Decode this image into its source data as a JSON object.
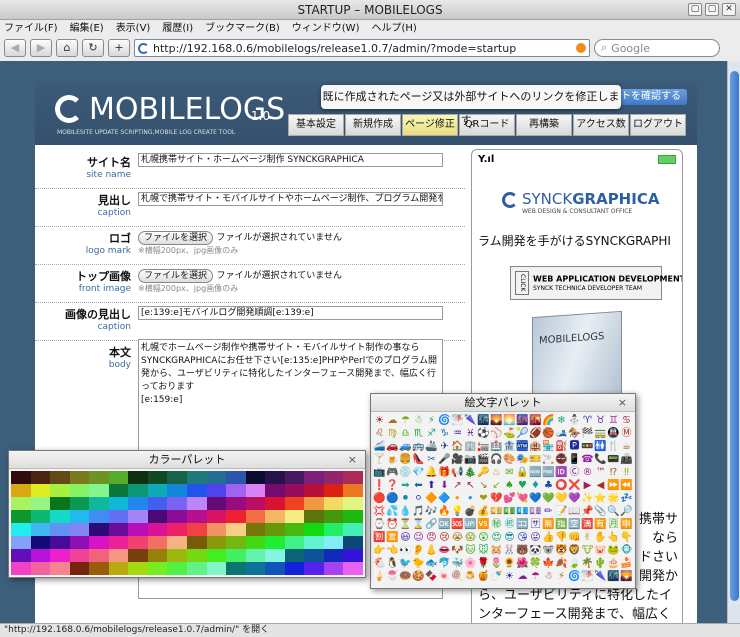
{
  "window": {
    "title": "STARTUP – MOBILELOGS",
    "buttons": [
      "▢",
      "▢",
      "✕"
    ]
  },
  "menu": [
    "ファイル(F)",
    "編集(E)",
    "表示(V)",
    "履歴(I)",
    "ブックマーク(B)",
    "ウィンドウ(W)",
    "ヘルプ(H)"
  ],
  "nav": {
    "back": "◀",
    "fwd": "▶",
    "home": "⌂",
    "reload": "↻",
    "add": "+",
    "url": "http://192.168.0.6/mobilelogs/release1.0.7/admin/?mode=startup",
    "search_placeholder": "Google"
  },
  "status": "\"http://192.168.0.6/mobilelogs/release1.0.7/admin/\" を開く",
  "header": {
    "logo": "MOBILELOGS",
    "version": "1.0",
    "tagline": "MOBILESITE UPDATE SCRIPTING,MOBILE LOG CREATE TOOL",
    "tooltip": "既に作成されたページ又は外部サイトへのリンクを修正します。",
    "confirm": "トを確認する",
    "tabs": [
      "基本設定",
      "新規作成",
      "ページ修正",
      "QRコード",
      "再構築",
      "アクセス数",
      "ログアウト"
    ]
  },
  "form": {
    "site_name": {
      "jp": "サイト名",
      "en": "site name",
      "value": "札幌携帯サイト・ホームページ制作 SYNCKGRAPHICA"
    },
    "caption": {
      "jp": "見出し",
      "en": "caption",
      "value": "札幌で携帯サイト・モバイルサイトやホームページ制作、プログラム開発を手がけ"
    },
    "logo": {
      "jp": "ロゴ",
      "en": "logo mark",
      "button": "ファイルを選択",
      "note": "ファイルが選択されていません",
      "sub": "※横幅200px、jpg画像のみ"
    },
    "front": {
      "jp": "トップ画像",
      "en": "front image",
      "button": "ファイルを選択",
      "note": "ファイルが選択されていません",
      "sub": "※横幅200px、jpg画像のみ"
    },
    "img_caption": {
      "jp": "画像の見出し",
      "en": "caption",
      "value": "[e:139:e]モバイルログ開発順調[e:139:e]"
    },
    "body": {
      "jp": "本文",
      "en": "body",
      "lines": [
        "札幌でホームページ制作や携帯サイト・モバイルサイト制作の事なら",
        "SYNCKGRAPHICAにお任せ下さい[e:135:e]PHPやPerlでのプログラム開発から、ユーザビリティに特化したインターフェース開発まで、幅広く行っております",
        "[e:159:e]"
      ]
    }
  },
  "preview": {
    "signal": "Y.ıl",
    "sg_name": "SYNCK",
    "sg_name_bold": "GRAPHICA",
    "sg_tag": "WEB DESIGN & CONSULTANT OFFICE",
    "text1": "ラム開発を手がけるSYNCKGRAPHI",
    "webapp": "WEB APPLICATION DEVELOPMENT",
    "webapp_tm": "TM",
    "webapp_sub": "SYNCK TECHNICA DEVELOPER TEAM",
    "click": "CLICK",
    "box": "MOBILELOGS",
    "text2": "携帯サ\nなら\nドさい\n開発か",
    "text3": "ら、ユーザビリティに特化したインターフェース開発まで、幅広く行って"
  },
  "emoji_palette": {
    "title": "絵文字パレット",
    "close": "×",
    "glyphs": "☀☁☂☃⚡🌀🌁🌂🌃🌄🌅🌆🌇🌈❄⛄♈♉♊♋♌♍♎♏♐♑♒♓⚽⚾⛳🎾🏈🏀🎿🏇🏁🚃🚇Ⓜ🚄🚗🚙🚌🚢✈🏠🏢🏣🏥🏦🏧🏨🏪⛽🅿🚥🚻🍴☕🍸🍺🍔👠✂🎤🎥📷🎬🎧🎨🎭🎫🚬🚭📱☎📞📟📠📺🎮💿💎🔔🎁📢🎄🔑♨✉🔒🆕🆓🆔Ⓒ®™⁉‼❗❓➡⬅⬆⬇↗↖↘↙♠♥♦♣⭕❌▶◀⏩⏪🔴🔵⚫⚪🔶🔷🔸🔹❤💔💕💘💙💚💛💜✨⭐🌟💤💢💦💧🎵🎶🔥💡💣💰💴💵💶💷✏📝📖📌📎🔍🔎⌚⏰⏳⌛🔗🆗🆘🆙🆚㊙㊗🈁🈂🈚🈯🈳🈵🈶🈷🈸🈹🈺😃😉😠😢😭😱😲😍😎😘😜👍👎👊✌✋👆👇👉👈👀👂👃👄🐶🐱🐭🐹🐰🐻🐼🐨🐯🦁🐮🐷🐸🐵🐔🐧🐦🐤🐟🐬🐳🌸🌹🌷🌻🌺🍀🍁🍂🍃🌴🌵🎂🍰🍦🍧🍩🍪🍫🍬🍭🍮🍯🍼"
  },
  "color_palette": {
    "title": "カラーパレット",
    "close": "×"
  }
}
